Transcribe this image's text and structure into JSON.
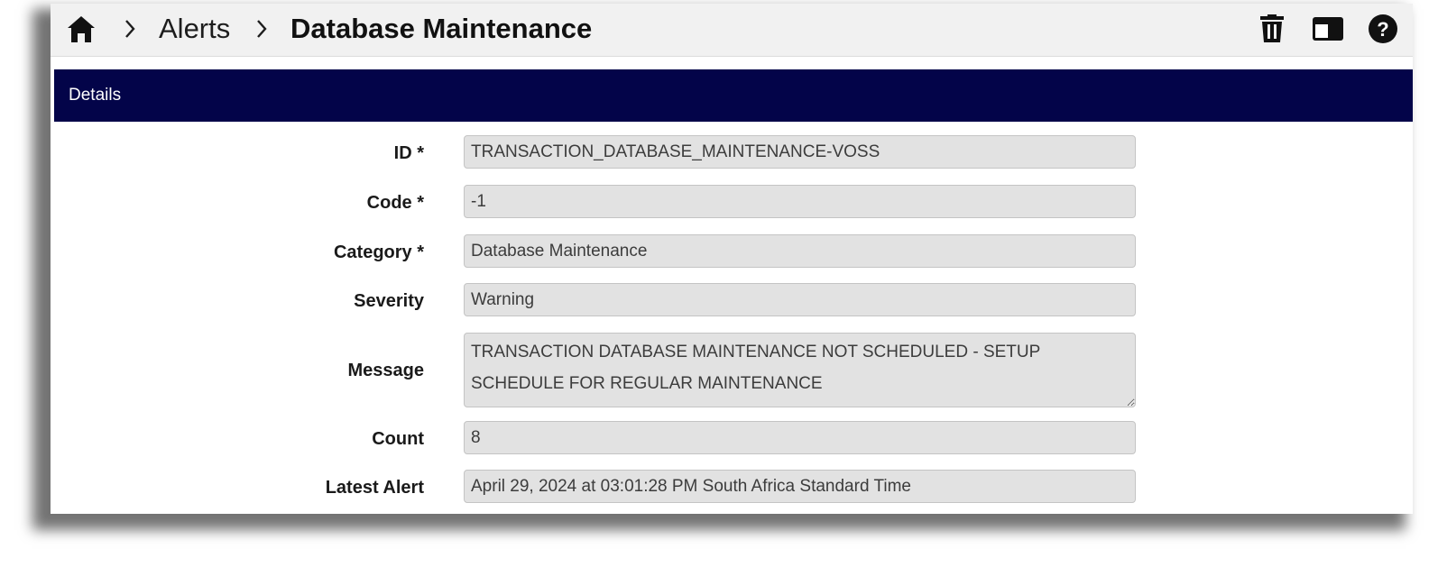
{
  "breadcrumb": {
    "home_icon": "home-icon",
    "separator_icon": "chevron-right-icon",
    "parent": "Alerts",
    "current": "Database Maintenance"
  },
  "toolbar": {
    "delete_icon": "trash-icon",
    "layout_icon": "panel-toggle-icon",
    "help_icon": "help-icon"
  },
  "section": {
    "title": "Details"
  },
  "fields": {
    "id": {
      "label": "ID *",
      "value": "TRANSACTION_DATABASE_MAINTENANCE-VOSS"
    },
    "code": {
      "label": "Code *",
      "value": "-1"
    },
    "category": {
      "label": "Category *",
      "value": "Database Maintenance"
    },
    "severity": {
      "label": "Severity",
      "value": "Warning"
    },
    "message": {
      "label": "Message",
      "value": "TRANSACTION DATABASE MAINTENANCE NOT SCHEDULED - SETUP SCHEDULE FOR REGULAR MAINTENANCE"
    },
    "count": {
      "label": "Count",
      "value": "8"
    },
    "latest_alert": {
      "label": "Latest Alert",
      "value": "April 29, 2024 at 03:01:28 PM South Africa Standard Time"
    }
  },
  "colors": {
    "header_background": "#030449",
    "topbar_background": "#f1f1f1",
    "field_background": "#e2e2e2"
  }
}
